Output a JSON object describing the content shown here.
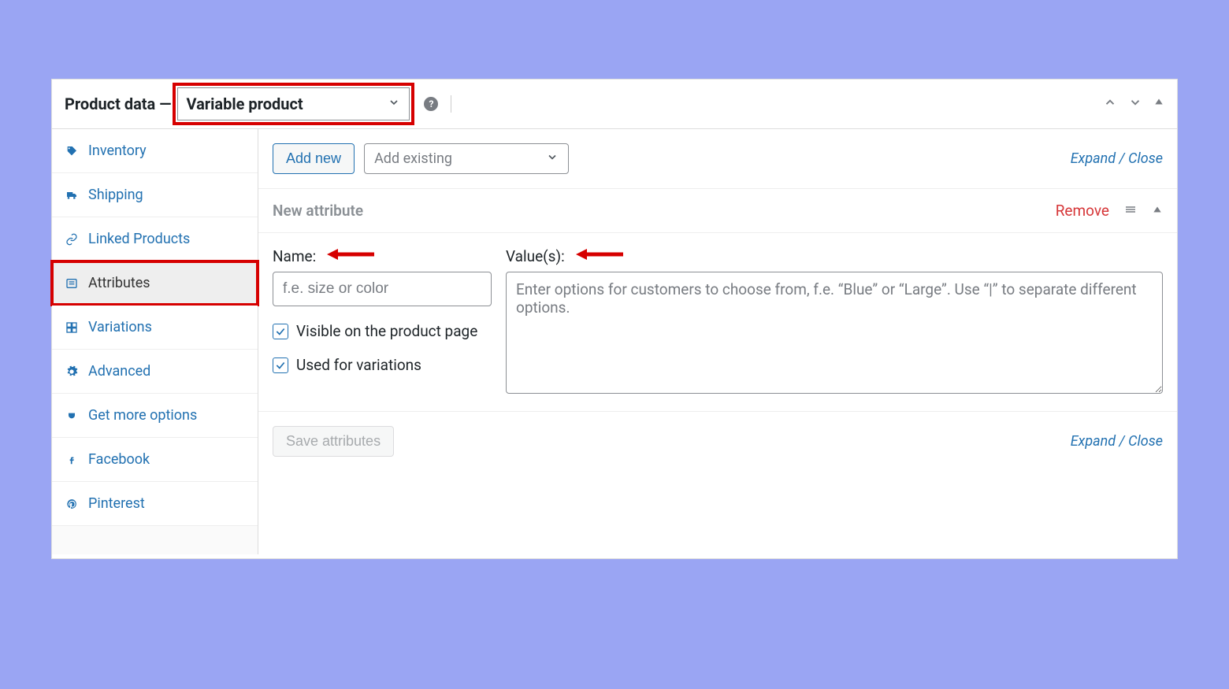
{
  "header": {
    "title": "Product data —",
    "product_type": "Variable product",
    "help_glyph": "?"
  },
  "sidebar": {
    "items": [
      {
        "label": "Inventory"
      },
      {
        "label": "Shipping"
      },
      {
        "label": "Linked Products"
      },
      {
        "label": "Attributes"
      },
      {
        "label": "Variations"
      },
      {
        "label": "Advanced"
      },
      {
        "label": "Get more options"
      },
      {
        "label": "Facebook"
      },
      {
        "label": "Pinterest"
      }
    ]
  },
  "toolbar": {
    "add_new": "Add new",
    "add_existing": "Add existing",
    "expand_close": "Expand / Close"
  },
  "attribute": {
    "section_title": "New attribute",
    "remove": "Remove",
    "name_label": "Name:",
    "name_placeholder": "f.e. size or color",
    "values_label": "Value(s):",
    "values_placeholder": "Enter options for customers to choose from, f.e. “Blue” or “Large”. Use “|” to separate different options.",
    "visible_label": "Visible on the product page",
    "used_variations_label": "Used for variations"
  },
  "footer": {
    "save": "Save attributes",
    "expand_close": "Expand / Close"
  }
}
